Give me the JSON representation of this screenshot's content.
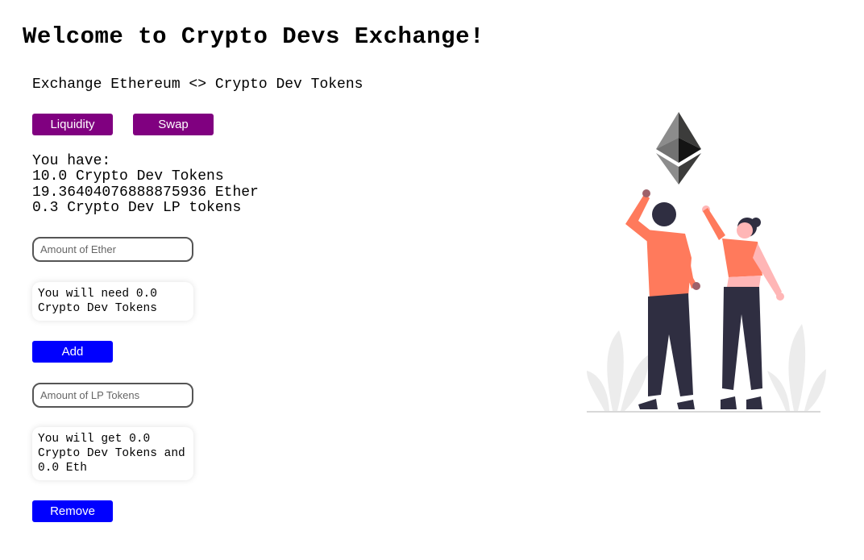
{
  "header": {
    "title": "Welcome to Crypto Devs Exchange!",
    "subtitle": "Exchange Ethereum <> Crypto Dev Tokens"
  },
  "tabs": {
    "liquidity_label": "Liquidity",
    "swap_label": "Swap"
  },
  "balances": {
    "heading": "You have:",
    "cd_tokens": "10.0 Crypto Dev Tokens",
    "ether": "19.36404076888875936 Ether",
    "lp_tokens": "0.3 Crypto Dev LP tokens"
  },
  "add_liquidity": {
    "ether_placeholder": "Amount of Ether",
    "ether_value": "",
    "need_text": "You will need 0.0 Crypto Dev Tokens",
    "button_label": "Add"
  },
  "remove_liquidity": {
    "lp_placeholder": "Amount of LP Tokens",
    "lp_value": "",
    "get_text": "You will get 0.0 Crypto Dev Tokens and 0.0 Eth",
    "button_label": "Remove"
  },
  "colors": {
    "tab_button": "#800080",
    "action_button": "#0000ff",
    "illustration_accent": "#ff7a5c",
    "illustration_dark": "#2f2e41"
  },
  "icons": {
    "hero": "ethereum-logo-celebration-illustration"
  }
}
